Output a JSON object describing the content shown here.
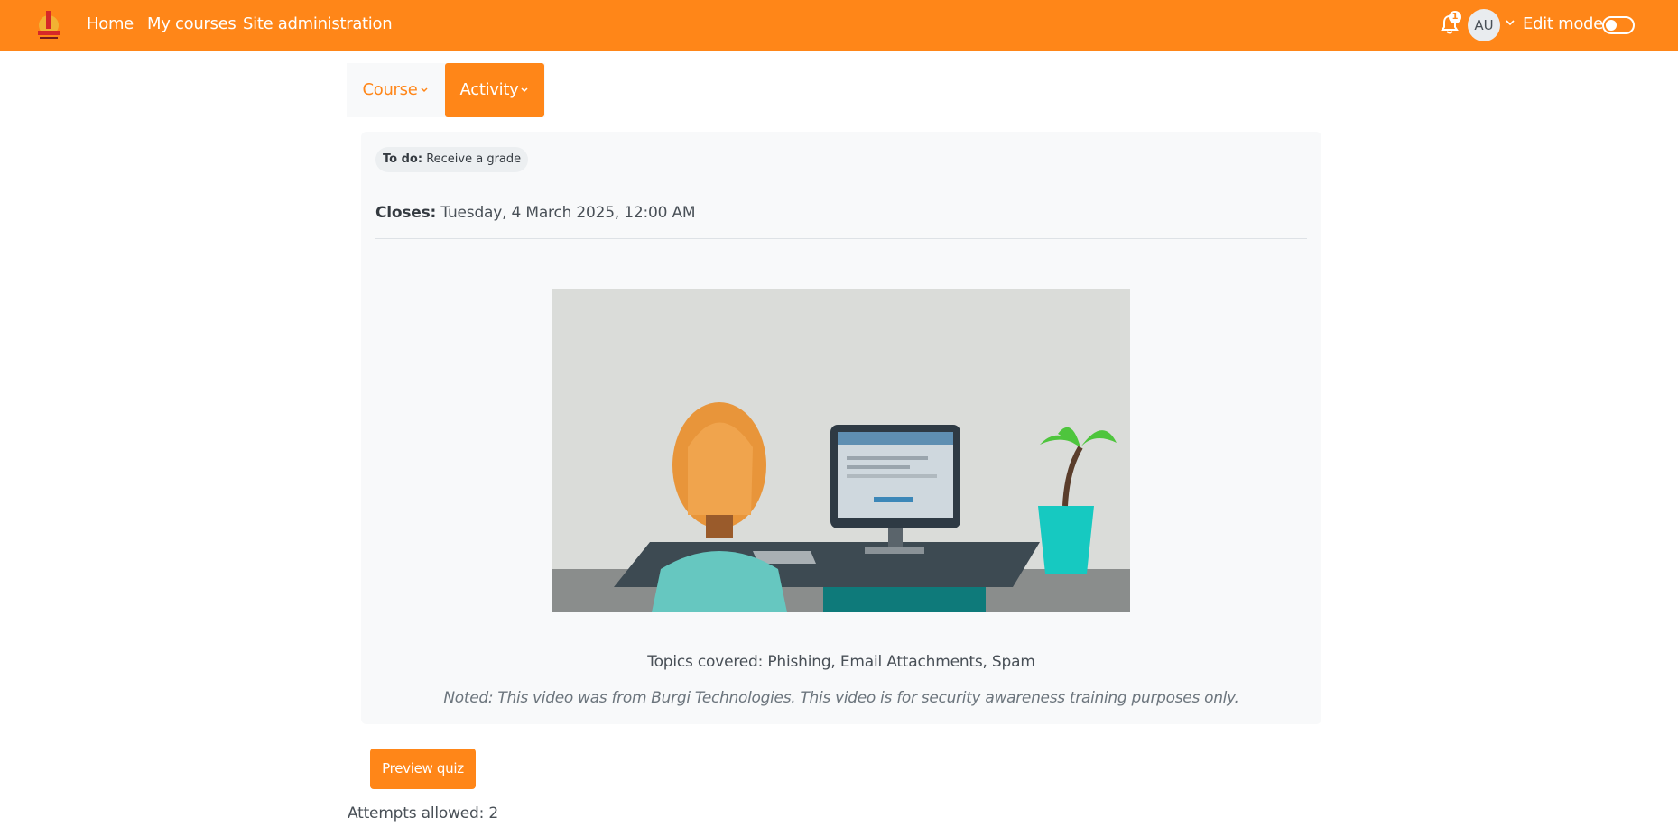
{
  "navbar": {
    "logo_icon": "site-logo-icon",
    "links": [
      {
        "label": "Home"
      },
      {
        "label": "My courses"
      },
      {
        "label": "Site administration"
      }
    ],
    "notifications": {
      "icon": "bell-icon",
      "count": "1"
    },
    "user_initials": "AU",
    "edit_mode_label": "Edit mode",
    "edit_mode_on": false,
    "bg_color": "#ff8618"
  },
  "secondary_nav": {
    "course_label": "Course",
    "activity_label": "Activity"
  },
  "activity": {
    "todo_prefix": "To do:",
    "todo_text": "Receive a grade",
    "closes_label": "Closes:",
    "closes_value": "Tuesday, 4 March 2025, 12:00 AM",
    "topics": "Topics covered: Phishing, Email Attachments, Spam",
    "noted": "Noted: This video was from Burgi Technologies. This video is for security awareness training purposes only."
  },
  "actions": {
    "preview_label": "Preview quiz",
    "attempts": "Attempts allowed: 2"
  },
  "colors": {
    "accent": "#ff8618",
    "card_bg": "#f8f9fa"
  }
}
